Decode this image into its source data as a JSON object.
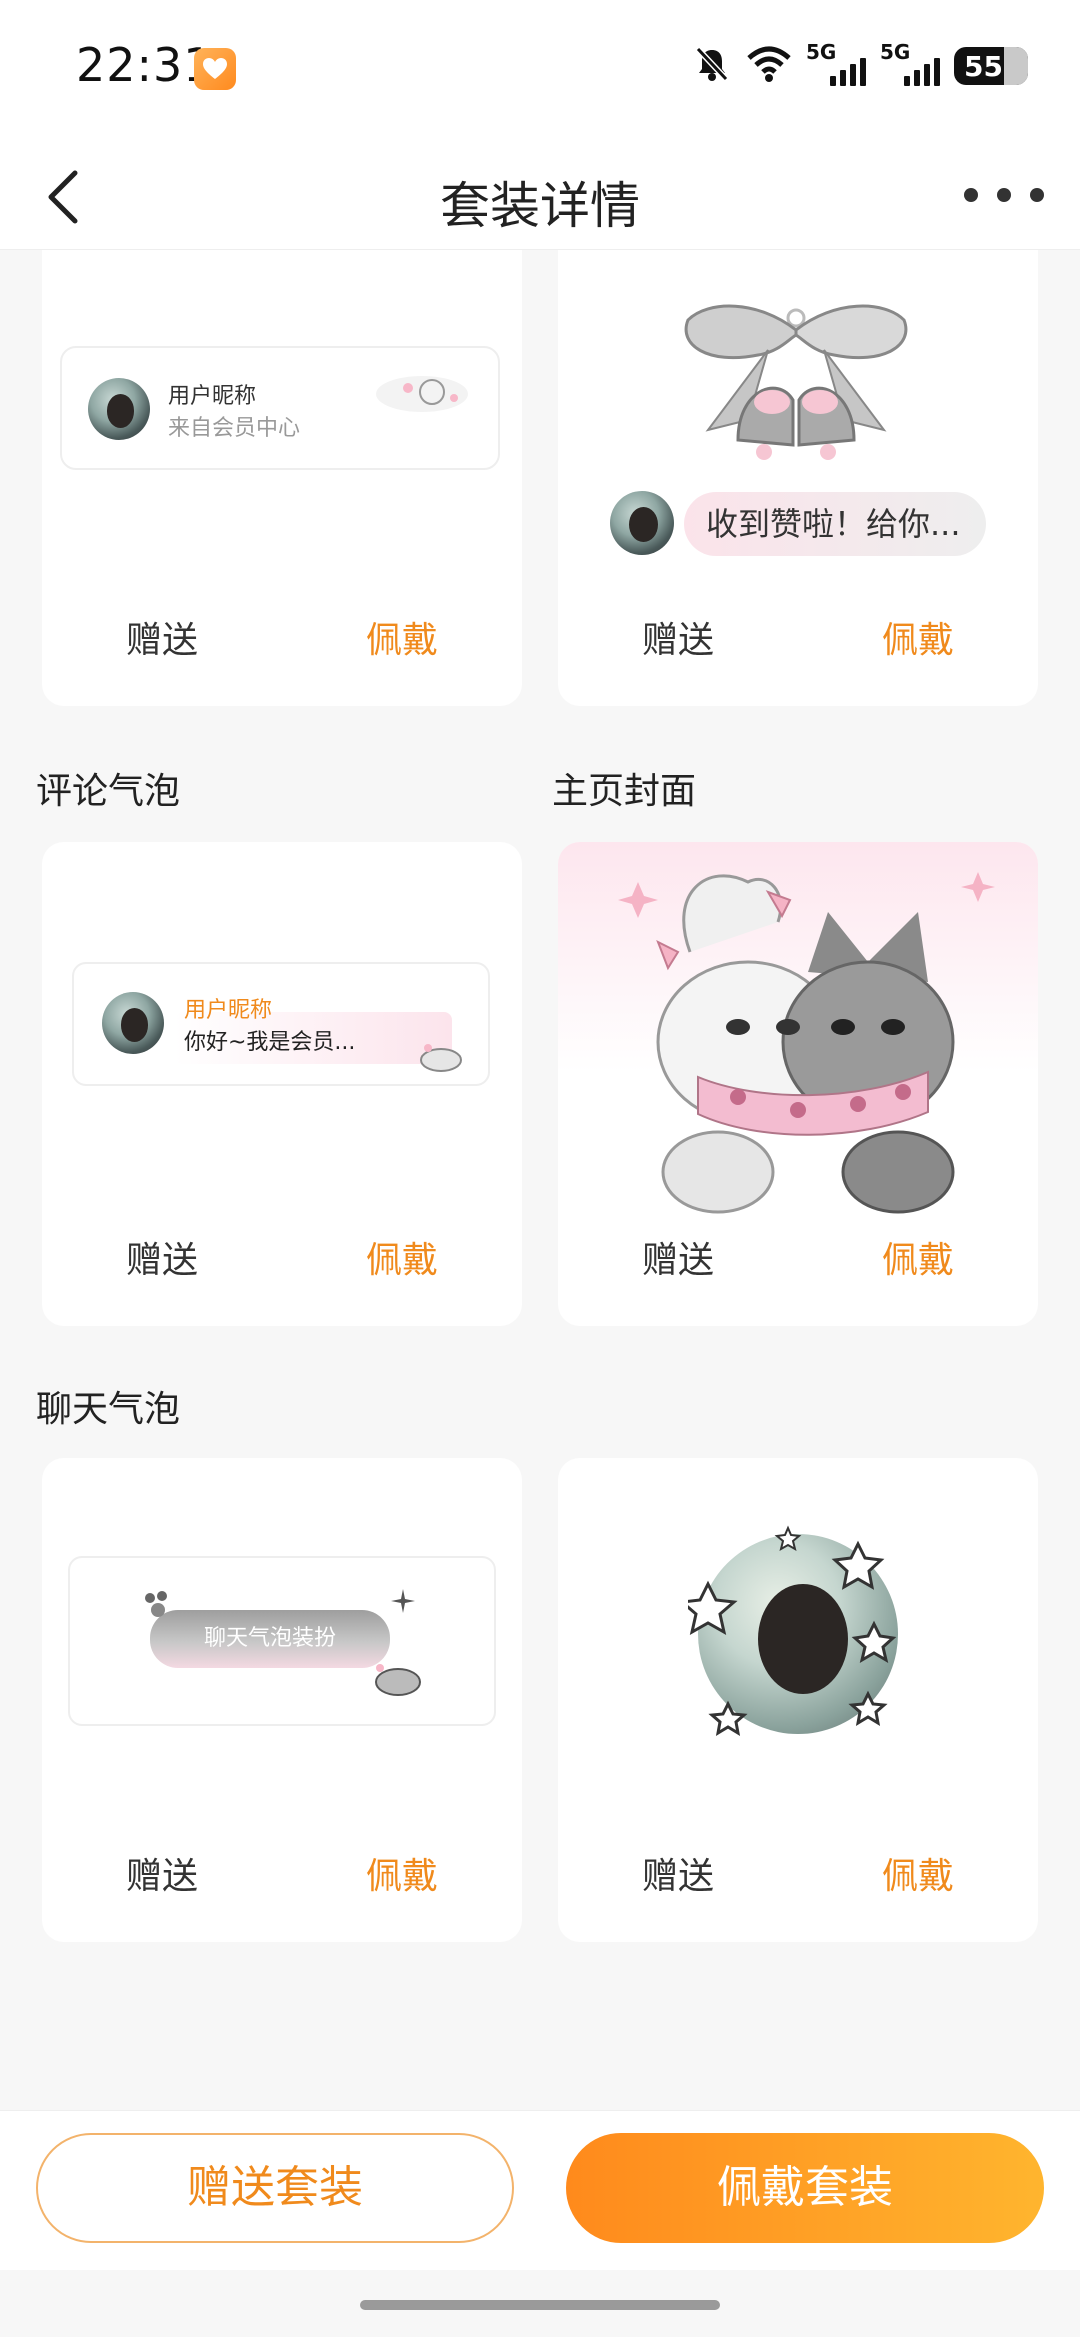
{
  "status_bar": {
    "time": "22:31",
    "network_1": "5G",
    "network_2": "5G",
    "battery": "55"
  },
  "nav": {
    "title": "套装详情"
  },
  "cards": [
    {
      "id": "nameplate",
      "preview": {
        "nickname": "用户昵称",
        "subtitle": "来自会员中心"
      },
      "gift_label": "赠送",
      "wear_label": "佩戴"
    },
    {
      "id": "like-effect",
      "preview": {
        "pill_text": "收到赞啦！给你..."
      },
      "gift_label": "赠送",
      "wear_label": "佩戴"
    },
    {
      "id": "comment-bubble",
      "section_title": "评论气泡",
      "preview": {
        "nickname": "用户昵称",
        "text": "你好~我是会员..."
      },
      "gift_label": "赠送",
      "wear_label": "佩戴"
    },
    {
      "id": "home-cover",
      "section_title": "主页封面",
      "gift_label": "赠送",
      "wear_label": "佩戴"
    },
    {
      "id": "chat-bubble",
      "section_title": "聊天气泡",
      "preview": {
        "bubble_text": "聊天气泡装扮"
      },
      "gift_label": "赠送",
      "wear_label": "佩戴"
    },
    {
      "id": "avatar-frame",
      "gift_label": "赠送",
      "wear_label": "佩戴"
    }
  ],
  "bottom": {
    "gift_suit": "赠送套装",
    "wear_suit": "佩戴套装"
  },
  "colors": {
    "accent": "#f08a1c",
    "accent_gradient_end": "#ffb52e"
  }
}
